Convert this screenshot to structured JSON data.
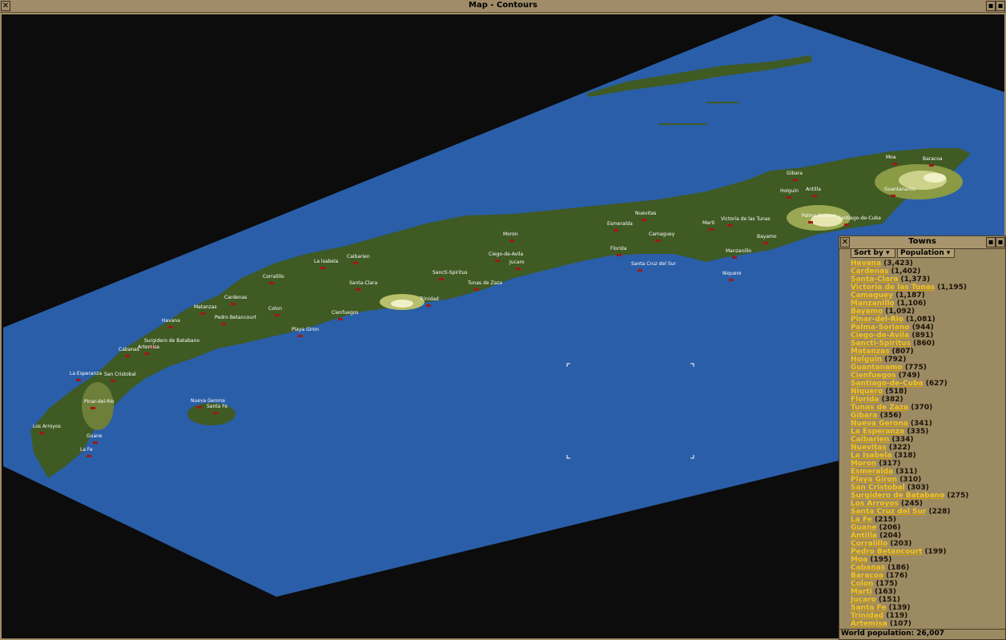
{
  "window": {
    "title": "Map - Contours"
  },
  "colors": {
    "ocean": "#2a5ea8",
    "land": "#3f5a23",
    "highland": "#b7c06a",
    "peak": "#f2f0c8",
    "town": "#a01818"
  },
  "map_labels": [
    {
      "name": "Havana"
    },
    {
      "name": "Cardenas"
    },
    {
      "name": "Santa-Clara"
    },
    {
      "name": "Victoria de las Tunas"
    },
    {
      "name": "Camaguey"
    },
    {
      "name": "Manzanillo"
    },
    {
      "name": "Bayamo"
    },
    {
      "name": "Pinar-del-Rio"
    },
    {
      "name": "Palma-Soriano"
    },
    {
      "name": "Ciego-de-Avila"
    },
    {
      "name": "Sancti-Spiritus"
    },
    {
      "name": "Matanzas"
    },
    {
      "name": "Holguin"
    },
    {
      "name": "Guantanamo"
    },
    {
      "name": "Cienfuegos"
    },
    {
      "name": "Santiago-de-Cuba"
    },
    {
      "name": "Niquero"
    },
    {
      "name": "Florida"
    },
    {
      "name": "Tunas de Zaza"
    },
    {
      "name": "Gibara"
    },
    {
      "name": "Nueva Gerona"
    },
    {
      "name": "La Esperanza"
    },
    {
      "name": "Caibarien"
    },
    {
      "name": "Nuevitas"
    },
    {
      "name": "La Isabela"
    },
    {
      "name": "Moron"
    },
    {
      "name": "Esmeralda"
    },
    {
      "name": "Playa Giron"
    },
    {
      "name": "San Cristobal"
    },
    {
      "name": "Surgidero de Batabano"
    },
    {
      "name": "Los Arroyos"
    },
    {
      "name": "Santa Cruz del Sur"
    },
    {
      "name": "La Fe"
    },
    {
      "name": "Guane"
    },
    {
      "name": "Antilla"
    },
    {
      "name": "Corralillo"
    },
    {
      "name": "Pedro Betancourt"
    },
    {
      "name": "Moa"
    },
    {
      "name": "Cabanas"
    },
    {
      "name": "Baracoa"
    },
    {
      "name": "Colon"
    },
    {
      "name": "Marti"
    },
    {
      "name": "Jucaro"
    },
    {
      "name": "Santa Fe"
    },
    {
      "name": "Trinidad"
    },
    {
      "name": "Artemisa"
    }
  ],
  "towns_panel": {
    "title": "Towns",
    "sort_by_label": "Sort by",
    "sort_value": "Population",
    "towns": [
      {
        "name": "Havana",
        "pop": "(3,423)"
      },
      {
        "name": "Cardenas",
        "pop": "(1,402)"
      },
      {
        "name": "Santa-Clara",
        "pop": "(1,373)"
      },
      {
        "name": "Victoria de las Tunas",
        "pop": "(1,195)"
      },
      {
        "name": "Camaguey",
        "pop": "(1,187)"
      },
      {
        "name": "Manzanillo",
        "pop": "(1,106)"
      },
      {
        "name": "Bayamo",
        "pop": "(1,092)"
      },
      {
        "name": "Pinar-del-Rio",
        "pop": "(1,081)"
      },
      {
        "name": "Palma-Soriano",
        "pop": "(944)"
      },
      {
        "name": "Ciego-de-Avila",
        "pop": "(891)"
      },
      {
        "name": "Sancti-Spiritus",
        "pop": "(860)"
      },
      {
        "name": "Matanzas",
        "pop": "(807)"
      },
      {
        "name": "Holguin",
        "pop": "(792)"
      },
      {
        "name": "Guantanamo",
        "pop": "(775)"
      },
      {
        "name": "Cienfuegos",
        "pop": "(749)"
      },
      {
        "name": "Santiago-de-Cuba",
        "pop": "(627)"
      },
      {
        "name": "Niquero",
        "pop": "(518)"
      },
      {
        "name": "Florida",
        "pop": "(382)"
      },
      {
        "name": "Tunas de Zaza",
        "pop": "(370)"
      },
      {
        "name": "Gibara",
        "pop": "(356)"
      },
      {
        "name": "Nueva Gerona",
        "pop": "(341)"
      },
      {
        "name": "La Esperanza",
        "pop": "(335)"
      },
      {
        "name": "Caibarien",
        "pop": "(334)"
      },
      {
        "name": "Nuevitas",
        "pop": "(322)"
      },
      {
        "name": "La Isabela",
        "pop": "(318)"
      },
      {
        "name": "Moron",
        "pop": "(317)"
      },
      {
        "name": "Esmeralda",
        "pop": "(311)"
      },
      {
        "name": "Playa Giron",
        "pop": "(310)"
      },
      {
        "name": "San Cristobal",
        "pop": "(303)"
      },
      {
        "name": "Surgidero de Batabano",
        "pop": "(275)"
      },
      {
        "name": "Los Arroyos",
        "pop": "(245)"
      },
      {
        "name": "Santa Cruz del Sur",
        "pop": "(228)"
      },
      {
        "name": "La Fe",
        "pop": "(215)"
      },
      {
        "name": "Guane",
        "pop": "(206)"
      },
      {
        "name": "Antilla",
        "pop": "(204)"
      },
      {
        "name": "Corralillo",
        "pop": "(203)"
      },
      {
        "name": "Pedro Betancourt",
        "pop": "(199)"
      },
      {
        "name": "Moa",
        "pop": "(195)"
      },
      {
        "name": "Cabanas",
        "pop": "(186)"
      },
      {
        "name": "Baracoa",
        "pop": "(176)"
      },
      {
        "name": "Colon",
        "pop": "(175)"
      },
      {
        "name": "Marti",
        "pop": "(163)"
      },
      {
        "name": "Jucaro",
        "pop": "(151)"
      },
      {
        "name": "Santa Fe",
        "pop": "(139)"
      },
      {
        "name": "Trinidad",
        "pop": "(119)"
      },
      {
        "name": "Artemisa",
        "pop": "(107)"
      }
    ],
    "world_population": "World population: 26,007"
  }
}
